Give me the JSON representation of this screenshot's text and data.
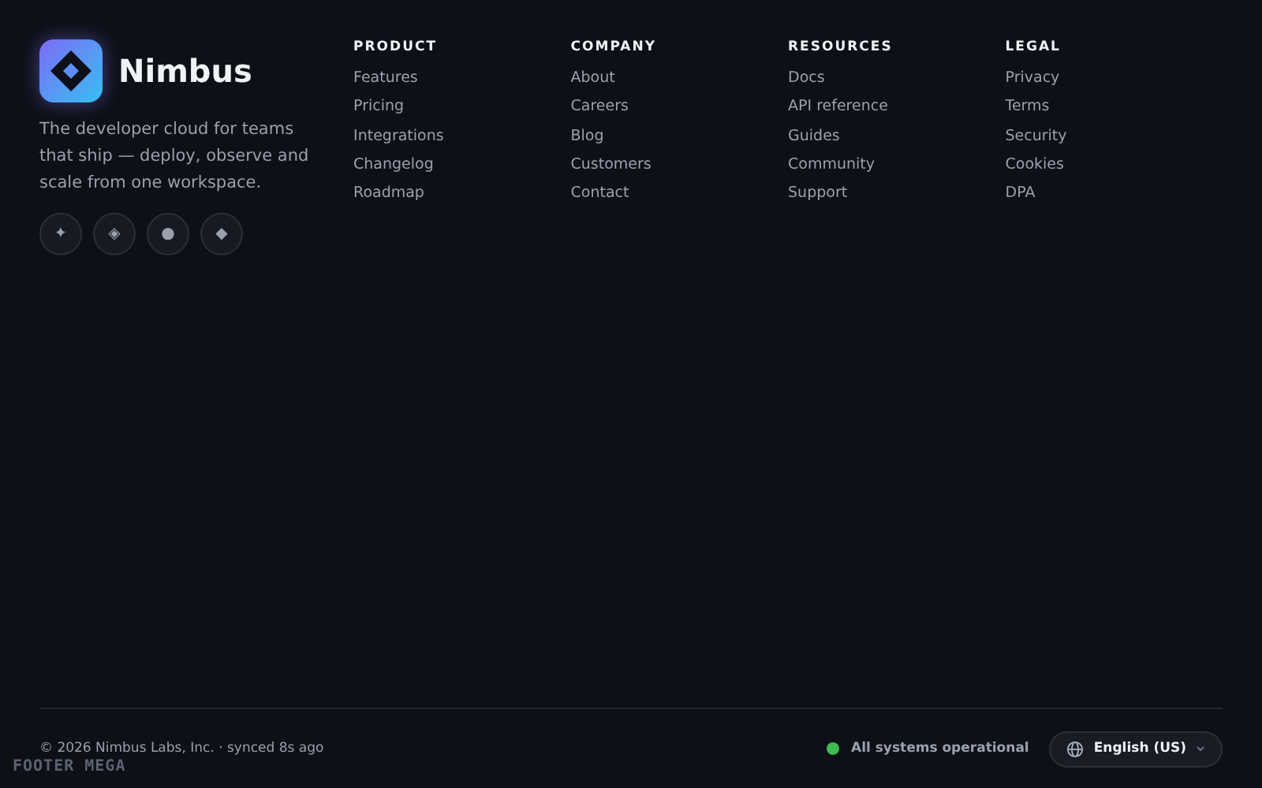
{
  "brand": {
    "name": "Nimbus",
    "tagline": "The developer cloud for teams that ship — deploy, observe and scale from one workspace.",
    "social": [
      "✦",
      "◈",
      "●",
      "◆"
    ]
  },
  "columns": [
    {
      "heading": "PRODUCT",
      "links": [
        "Features",
        "Pricing",
        "Integrations",
        "Changelog",
        "Roadmap"
      ]
    },
    {
      "heading": "COMPANY",
      "links": [
        "About",
        "Careers",
        "Blog",
        "Customers",
        "Contact"
      ]
    },
    {
      "heading": "RESOURCES",
      "links": [
        "Docs",
        "API reference",
        "Guides",
        "Community",
        "Support"
      ]
    },
    {
      "heading": "LEGAL",
      "links": [
        "Privacy",
        "Terms",
        "Security",
        "Cookies",
        "DPA"
      ]
    }
  ],
  "bottom": {
    "copyright": "© 2026 Nimbus Labs, Inc. · synced 8s ago",
    "status": {
      "label": "All systems operational",
      "color": "#3fb950"
    },
    "language": "English (US)"
  },
  "caption": "FOOTER MEGA"
}
